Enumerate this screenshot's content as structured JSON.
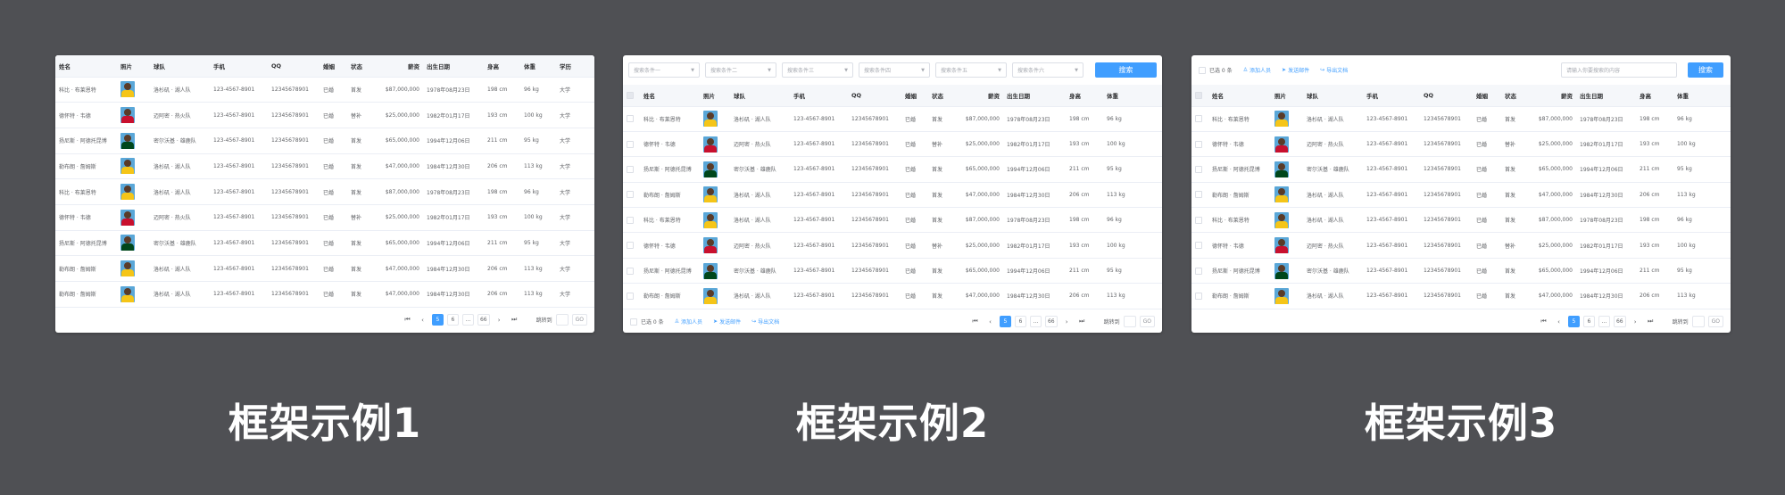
{
  "columns": {
    "name": "姓名",
    "photo": "照片",
    "team": "球队",
    "phone": "手机",
    "qq": "QQ",
    "marriage": "婚姻",
    "status": "状态",
    "salary": "薪资",
    "birth": "出生日期",
    "height": "身高",
    "weight": "体重",
    "education": "学历"
  },
  "rows": [
    {
      "name": "科比 · 布莱恩特",
      "team": "洛杉矶 · 湖人队",
      "phone": "123-4567-8901",
      "qq": "12345678901",
      "marriage": "已婚",
      "status": "首发",
      "salary": "$87,000,000",
      "birth": "1978年08月23日",
      "height": "198 cm",
      "weight": "96 kg",
      "education": "大学",
      "jersey": "#f5c518"
    },
    {
      "name": "德怀特 · 韦德",
      "team": "迈阿密 · 热火队",
      "phone": "123-4567-8901",
      "qq": "12345678901",
      "marriage": "已婚",
      "status": "替补",
      "salary": "$25,000,000",
      "birth": "1982年01月17日",
      "height": "193 cm",
      "weight": "100 kg",
      "education": "大学",
      "jersey": "#c8102e"
    },
    {
      "name": "扬尼斯 · 阿德托昆博",
      "team": "密尔沃基 · 雄鹿队",
      "phone": "123-4567-8901",
      "qq": "12345678901",
      "marriage": "已婚",
      "status": "首发",
      "salary": "$65,000,000",
      "birth": "1994年12月06日",
      "height": "211 cm",
      "weight": "95 kg",
      "education": "大学",
      "jersey": "#00471b"
    },
    {
      "name": "勒布朗 · 詹姆斯",
      "team": "洛杉矶 · 湖人队",
      "phone": "123-4567-8901",
      "qq": "12345678901",
      "marriage": "已婚",
      "status": "首发",
      "salary": "$47,000,000",
      "birth": "1984年12月30日",
      "height": "206 cm",
      "weight": "113 kg",
      "education": "大学",
      "jersey": "#f5c518"
    },
    {
      "name": "科比 · 布莱恩特",
      "team": "洛杉矶 · 湖人队",
      "phone": "123-4567-8901",
      "qq": "12345678901",
      "marriage": "已婚",
      "status": "首发",
      "salary": "$87,000,000",
      "birth": "1978年08月23日",
      "height": "198 cm",
      "weight": "96 kg",
      "education": "大学",
      "jersey": "#f5c518"
    },
    {
      "name": "德怀特 · 韦德",
      "team": "迈阿密 · 热火队",
      "phone": "123-4567-8901",
      "qq": "12345678901",
      "marriage": "已婚",
      "status": "替补",
      "salary": "$25,000,000",
      "birth": "1982年01月17日",
      "height": "193 cm",
      "weight": "100 kg",
      "education": "大学",
      "jersey": "#c8102e"
    },
    {
      "name": "扬尼斯 · 阿德托昆博",
      "team": "密尔沃基 · 雄鹿队",
      "phone": "123-4567-8901",
      "qq": "12345678901",
      "marriage": "已婚",
      "status": "首发",
      "salary": "$65,000,000",
      "birth": "1994年12月06日",
      "height": "211 cm",
      "weight": "95 kg",
      "education": "大学",
      "jersey": "#00471b"
    },
    {
      "name": "勒布朗 · 詹姆斯",
      "team": "洛杉矶 · 湖人队",
      "phone": "123-4567-8901",
      "qq": "12345678901",
      "marriage": "已婚",
      "status": "首发",
      "salary": "$47,000,000",
      "birth": "1984年12月30日",
      "height": "206 cm",
      "weight": "113 kg",
      "education": "大学",
      "jersey": "#f5c518"
    },
    {
      "name": "勒布朗 · 詹姆斯",
      "team": "洛杉矶 · 湖人队",
      "phone": "123-4567-8901",
      "qq": "12345678901",
      "marriage": "已婚",
      "status": "首发",
      "salary": "$47,000,000",
      "birth": "1984年12月30日",
      "height": "206 cm",
      "weight": "113 kg",
      "education": "大学",
      "jersey": "#f5c518"
    }
  ],
  "pagination": {
    "pages": [
      "5",
      "6",
      "...",
      "66"
    ],
    "active_page": "5",
    "jump_label": "跳转到",
    "go_label": "GO",
    "icons": [
      "first-page-icon",
      "prev-page-icon",
      "next-page-icon",
      "last-page-icon"
    ]
  },
  "toolbar": {
    "filters": [
      "搜索条件一",
      "搜索条件二",
      "搜索条件三",
      "搜索条件四",
      "搜索条件五",
      "搜索条件六"
    ],
    "search_label": "搜索",
    "selected_count": "已选 0 条",
    "actions": [
      {
        "label": "添加人员",
        "icon": "user-plus-icon"
      },
      {
        "label": "发送邮件",
        "icon": "send-icon"
      },
      {
        "label": "导出文档",
        "icon": "share-icon"
      }
    ],
    "search_placeholder": "请输入你要搜索的内容"
  },
  "captions": [
    "框架示例1",
    "框架示例2",
    "框架示例3"
  ],
  "colors": {
    "background": "#4f5054",
    "accent": "#409eff",
    "header_bg": "#f5f7fa",
    "border": "#ebeef5"
  }
}
